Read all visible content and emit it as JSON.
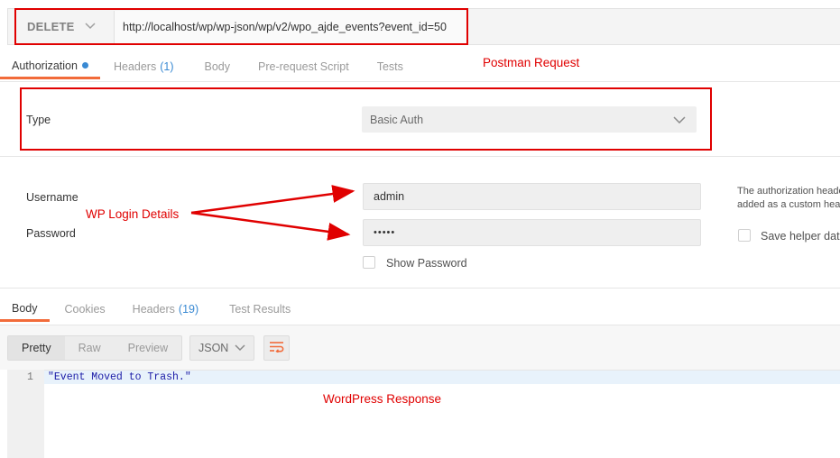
{
  "request": {
    "method": "DELETE",
    "url": "http://localhost/wp/wp-json/wp/v2/wpo_ajde_events?event_id=50"
  },
  "request_tabs": [
    {
      "label": "Authorization",
      "count": "",
      "active": true
    },
    {
      "label": "Headers",
      "count": "(1)",
      "active": false
    },
    {
      "label": "Body",
      "count": "",
      "active": false
    },
    {
      "label": "Pre-request Script",
      "count": "",
      "active": false
    },
    {
      "label": "Tests",
      "count": "",
      "active": false
    }
  ],
  "auth": {
    "type_label": "Type",
    "type_value": "Basic Auth",
    "username_label": "Username",
    "username_value": "admin",
    "password_label": "Password",
    "password_value": "•••••",
    "show_password_label": "Show Password",
    "help_text_1": "The authorization heade",
    "help_text_2": "added as a custom head",
    "save_helper_label": "Save helper data"
  },
  "response_tabs": [
    {
      "label": "Body",
      "count": "",
      "active": true
    },
    {
      "label": "Cookies",
      "count": "",
      "active": false
    },
    {
      "label": "Headers",
      "count": "(19)",
      "active": false
    },
    {
      "label": "Test Results",
      "count": "",
      "active": false
    }
  ],
  "response_view": {
    "modes": [
      "Pretty",
      "Raw",
      "Preview"
    ],
    "format": "JSON",
    "line_number": "1",
    "body": "\"Event Moved to Trash.\""
  },
  "annotations": {
    "request": "Postman Request",
    "login": "WP Login Details",
    "response": "WordPress Response"
  },
  "colors": {
    "annotation_red": "#e00000",
    "active_tab_underline": "#f26b3a",
    "count_blue": "#3a8ad3",
    "wrap_icon": "#f26b3a"
  }
}
